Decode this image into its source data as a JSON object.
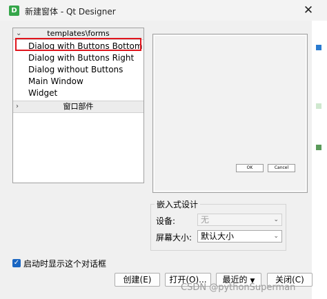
{
  "window": {
    "title": "新建窗体 - Qt Designer",
    "icon_letter": "D",
    "close_glyph": "✕"
  },
  "tree": {
    "groups": [
      {
        "label": "templates\\forms",
        "expanded": true,
        "items": [
          "Dialog with Buttons Bottom",
          "Dialog with Buttons Right",
          "Dialog without Buttons",
          "Main Window",
          "Widget"
        ],
        "selected_index": 0
      },
      {
        "label": "窗口部件",
        "expanded": false
      }
    ]
  },
  "preview": {
    "buttons": [
      "OK",
      "Cancel"
    ]
  },
  "embedded": {
    "title": "嵌入式设计",
    "device_label": "设备:",
    "device_value": "无",
    "screen_label": "屏幕大小:",
    "screen_value": "默认大小"
  },
  "startup_checkbox": {
    "label": "启动时显示这个对话框",
    "checked": true
  },
  "buttons": {
    "create": "创建(E)",
    "open": "打开(O)...",
    "recent": "最近的",
    "close": "关闭(C)"
  },
  "watermark": "CSDN @pythonSuperman",
  "colors": {
    "selection_outline": "#e0141c",
    "checkbox": "#1a66c2",
    "app_icon": "#35a64a"
  }
}
